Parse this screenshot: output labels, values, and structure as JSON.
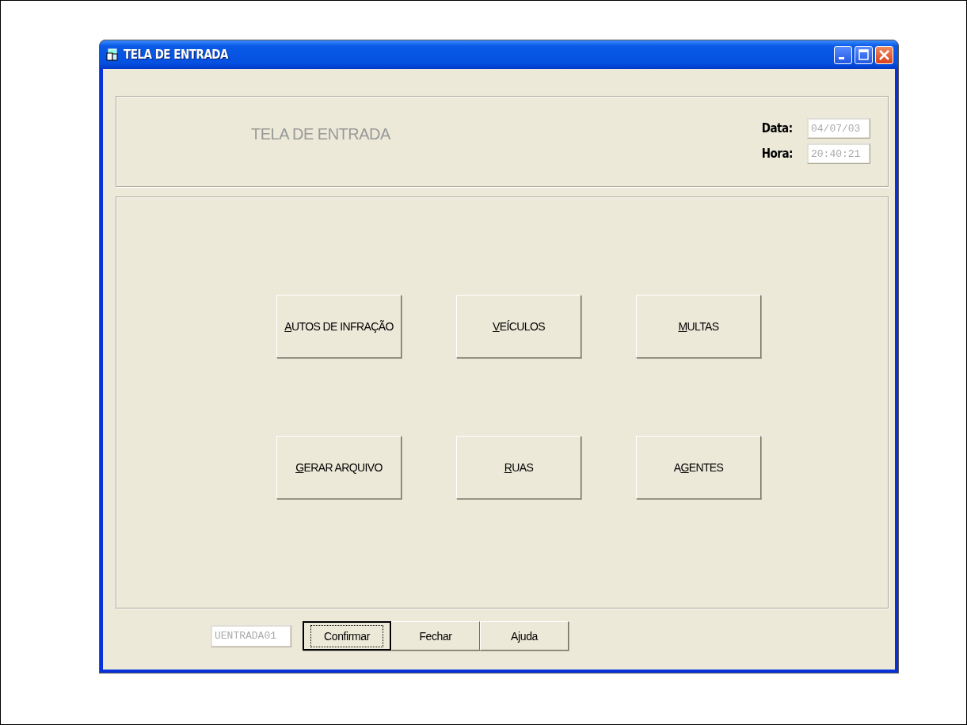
{
  "window": {
    "title": "TELA DE ENTRADA"
  },
  "header": {
    "heading": "TELA DE ENTRADA",
    "fields": [
      {
        "label": "Data:",
        "value": "04/07/03",
        "disabled": true
      },
      {
        "label": "Hora:",
        "value": "20:40:21",
        "disabled": true
      }
    ]
  },
  "menu_buttons": [
    {
      "accel": "A",
      "label_end": "UTOS DE INFRAÇÃO"
    },
    {
      "accel": "V",
      "label_end": "EÍCULOS"
    },
    {
      "accel": "M",
      "label_end": "ULTAS"
    },
    {
      "accel": "G",
      "label_end": "ERAR ARQUIVO"
    },
    {
      "accel": "R",
      "label_end": "UAS"
    },
    {
      "label_start": "A",
      "accel": "G",
      "label_end": "ENTES"
    }
  ],
  "footer": {
    "form_code": {
      "value": "UENTRADA01",
      "disabled": true
    },
    "buttons": [
      {
        "label": "Confirmar",
        "focused": true
      },
      {
        "label": "Fechar",
        "focused": false
      },
      {
        "label": "Ajuda",
        "focused": false
      }
    ]
  }
}
